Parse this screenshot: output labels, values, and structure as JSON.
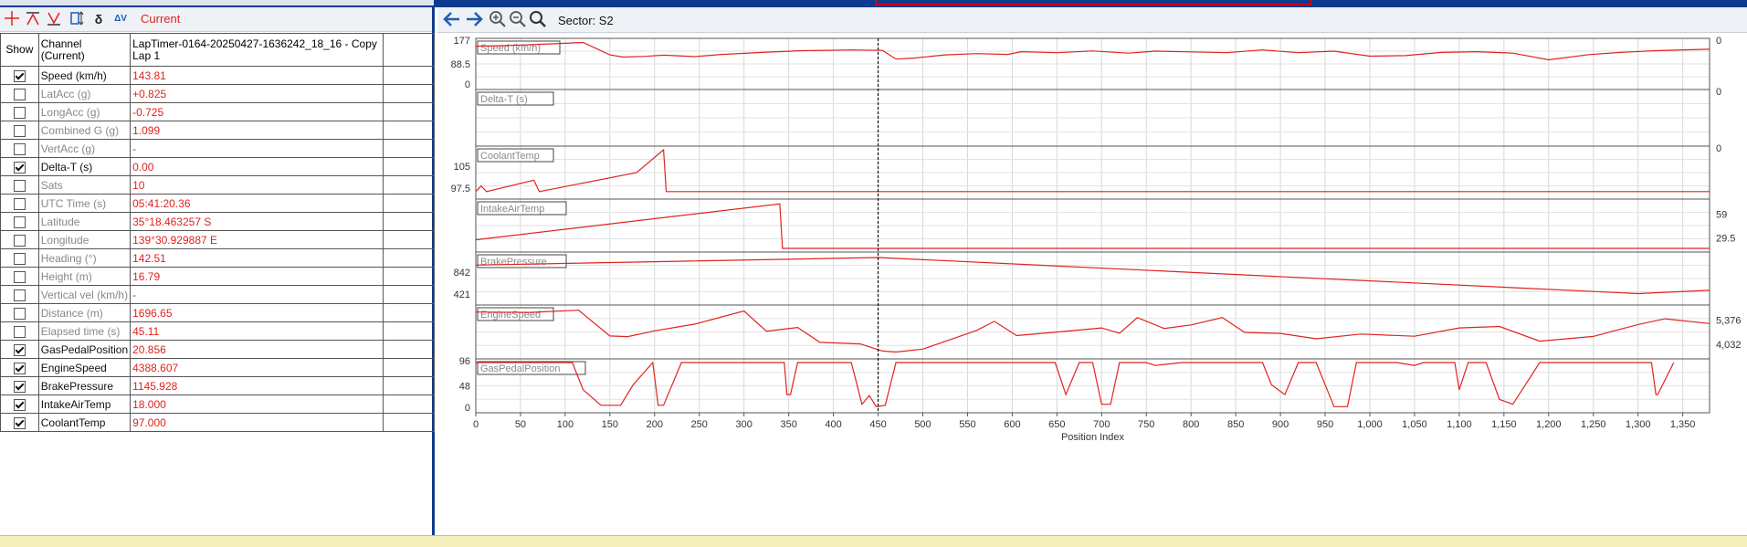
{
  "toolbar": {
    "current_label": "Current",
    "icons": [
      "crosshair-icon",
      "marker-up-icon",
      "marker-down-icon",
      "vertical-fit-icon",
      "delta-icon",
      "delta-v-icon"
    ]
  },
  "table": {
    "header": {
      "show": "Show",
      "channel": "Channel\n(Current)",
      "lap": "LapTimer-0164-20250427-1636242_18_16 - Copy\nLap 1"
    },
    "rows": [
      {
        "checked": true,
        "name": "Speed (km/h)",
        "value": "143.81"
      },
      {
        "checked": false,
        "name": "LatAcc (g)",
        "value": "+0.825"
      },
      {
        "checked": false,
        "name": "LongAcc (g)",
        "value": "-0.725"
      },
      {
        "checked": false,
        "name": "Combined G (g)",
        "value": "1.099"
      },
      {
        "checked": false,
        "name": "VertAcc (g)",
        "value": "-"
      },
      {
        "checked": true,
        "name": "Delta-T (s)",
        "value": "0.00"
      },
      {
        "checked": false,
        "name": "Sats",
        "value": "10"
      },
      {
        "checked": false,
        "name": "UTC Time (s)",
        "value": "05:41:20.36"
      },
      {
        "checked": false,
        "name": "Latitude",
        "value": "35°18.463257 S"
      },
      {
        "checked": false,
        "name": "Longitude",
        "value": "139°30.929887 E"
      },
      {
        "checked": false,
        "name": "Heading (°)",
        "value": "142.51"
      },
      {
        "checked": false,
        "name": "Height (m)",
        "value": "16.79"
      },
      {
        "checked": false,
        "name": "Vertical vel (km/h)",
        "value": "-"
      },
      {
        "checked": false,
        "name": "Distance (m)",
        "value": "1696.65"
      },
      {
        "checked": false,
        "name": "Elapsed time (s)",
        "value": "45.11"
      },
      {
        "checked": true,
        "name": "GasPedalPosition",
        "value": "20.856"
      },
      {
        "checked": true,
        "name": "EngineSpeed",
        "value": "4388.607"
      },
      {
        "checked": true,
        "name": "BrakePressure",
        "value": "1145.928"
      },
      {
        "checked": true,
        "name": "IntakeAirTemp",
        "value": "18.000"
      },
      {
        "checked": true,
        "name": "CoolantTemp",
        "value": "97.000"
      }
    ]
  },
  "plot_toolbar": {
    "sector_label": "Sector: S2",
    "icons": [
      "back-arrow-icon",
      "forward-arrow-icon",
      "zoom-in-icon",
      "zoom-out-icon",
      "zoom-fit-icon"
    ]
  },
  "chart_data": {
    "type": "line",
    "xlabel": "Position Index",
    "xlim": [
      0,
      1380
    ],
    "xticks": [
      0,
      50,
      100,
      150,
      200,
      250,
      300,
      350,
      400,
      450,
      500,
      550,
      600,
      650,
      700,
      750,
      800,
      850,
      900,
      950,
      1000,
      1050,
      1100,
      1150,
      1200,
      1250,
      1300,
      1350
    ],
    "xtick_labels": [
      "0",
      "50",
      "100",
      "150",
      "200",
      "250",
      "300",
      "350",
      "400",
      "450",
      "500",
      "550",
      "600",
      "650",
      "700",
      "750",
      "800",
      "850",
      "900",
      "950",
      "1,000",
      "1,050",
      "1,100",
      "1,150",
      "1,200",
      "1,250",
      "1,300",
      "1,350"
    ],
    "cursor_x": 450,
    "line_color": "#e0231e",
    "panels": [
      {
        "name": "Speed (km/h)",
        "ylim": [
          0,
          177
        ],
        "left_ticks": [
          "177",
          "88.5",
          "0"
        ],
        "right_ticks": [
          "0"
        ],
        "x": [
          0,
          25,
          60,
          100,
          120,
          150,
          165,
          190,
          210,
          245,
          275,
          320,
          365,
          420,
          455,
          470,
          490,
          525,
          560,
          595,
          610,
          650,
          690,
          730,
          760,
          800,
          840,
          880,
          920,
          960,
          1000,
          1040,
          1080,
          1120,
          1160,
          1200,
          1245,
          1280,
          1320,
          1380
        ],
        "y": [
          160,
          162,
          166,
          172,
          175,
          125,
          116,
          119,
          124,
          118,
          127,
          135,
          142,
          145,
          143,
          108,
          112,
          125,
          130,
          127,
          138,
          134,
          141,
          132,
          140,
          137,
          134,
          145,
          134,
          140,
          120,
          122,
          135,
          138,
          132,
          105,
          126,
          135,
          142,
          148
        ]
      },
      {
        "name": "Delta-T (s)",
        "ylim": [
          -1,
          1
        ],
        "left_ticks": [],
        "right_ticks": [
          "0"
        ],
        "x": [],
        "y": []
      },
      {
        "name": "CoolantTemp",
        "ylim": [
          96,
          108
        ],
        "left_ticks": [
          "105",
          "97.5"
        ],
        "right_ticks": [
          "0"
        ],
        "x": [
          0,
          6,
          12,
          65,
          71,
          180,
          210,
          213,
          1380
        ],
        "y": [
          97.0,
          98.5,
          97.0,
          100.0,
          97.0,
          102.0,
          108.0,
          97.0,
          97.0
        ]
      },
      {
        "name": "IntakeAirTemp",
        "ylim": [
          0,
          80
        ],
        "left_ticks": [],
        "right_ticks": [
          "59",
          "29.5"
        ],
        "x": [
          0,
          340,
          340,
          343,
          1380
        ],
        "y": [
          15,
          78,
          78,
          0,
          0
        ]
      },
      {
        "name": "BrakePressure",
        "ylim": [
          0,
          1260
        ],
        "left_ticks": [
          "842",
          "421"
        ],
        "right_ticks": [],
        "x": [
          0,
          450,
          1300,
          1380
        ],
        "y": [
          1000,
          1210,
          215,
          305
        ]
      },
      {
        "name": "EngineSpeed",
        "ylim": [
          3850,
          6200
        ],
        "left_ticks": [],
        "right_ticks": [
          "5,376",
          "4,032"
        ],
        "x": [
          0,
          60,
          115,
          150,
          170,
          200,
          245,
          300,
          325,
          345,
          360,
          385,
          430,
          455,
          470,
          500,
          560,
          580,
          605,
          650,
          700,
          720,
          740,
          770,
          800,
          835,
          860,
          900,
          940,
          990,
          1050,
          1100,
          1145,
          1190,
          1250,
          1300,
          1330,
          1380
        ],
        "y": [
          6030,
          6010,
          6120,
          4820,
          4790,
          5080,
          5420,
          6080,
          5060,
          5170,
          5250,
          4500,
          4420,
          4060,
          4010,
          4160,
          5100,
          5560,
          4840,
          5020,
          5230,
          4960,
          5750,
          5200,
          5380,
          5750,
          5000,
          4950,
          4680,
          4920,
          4810,
          5230,
          5300,
          4560,
          4800,
          5400,
          5690,
          5450
        ]
      },
      {
        "name": "GasPedalPosition",
        "ylim": [
          0,
          96
        ],
        "left_ticks": [
          "96",
          "48",
          "0"
        ],
        "right_ticks": [],
        "x": [
          0,
          108,
          120,
          140,
          148,
          162,
          176,
          198,
          204,
          210,
          230,
          345,
          348,
          352,
          360,
          420,
          432,
          440,
          448,
          458,
          470,
          520,
          648,
          660,
          675,
          690,
          700,
          710,
          720,
          740,
          750,
          760,
          790,
          880,
          890,
          905,
          920,
          930,
          940,
          960,
          975,
          985,
          1030,
          1050,
          1060,
          1080,
          1095,
          1100,
          1110,
          1130,
          1145,
          1160,
          1190,
          1315,
          1320,
          1322,
          1340
        ],
        "y": [
          96,
          96,
          40,
          8,
          8,
          8,
          50,
          96,
          8,
          8,
          96,
          96,
          30,
          30,
          96,
          96,
          10,
          28,
          5,
          8,
          96,
          96,
          96,
          30,
          96,
          96,
          10,
          10,
          96,
          96,
          96,
          90,
          96,
          96,
          50,
          30,
          96,
          96,
          96,
          5,
          5,
          96,
          96,
          90,
          96,
          96,
          96,
          40,
          96,
          96,
          20,
          10,
          96,
          96,
          30,
          30,
          96
        ]
      }
    ]
  }
}
